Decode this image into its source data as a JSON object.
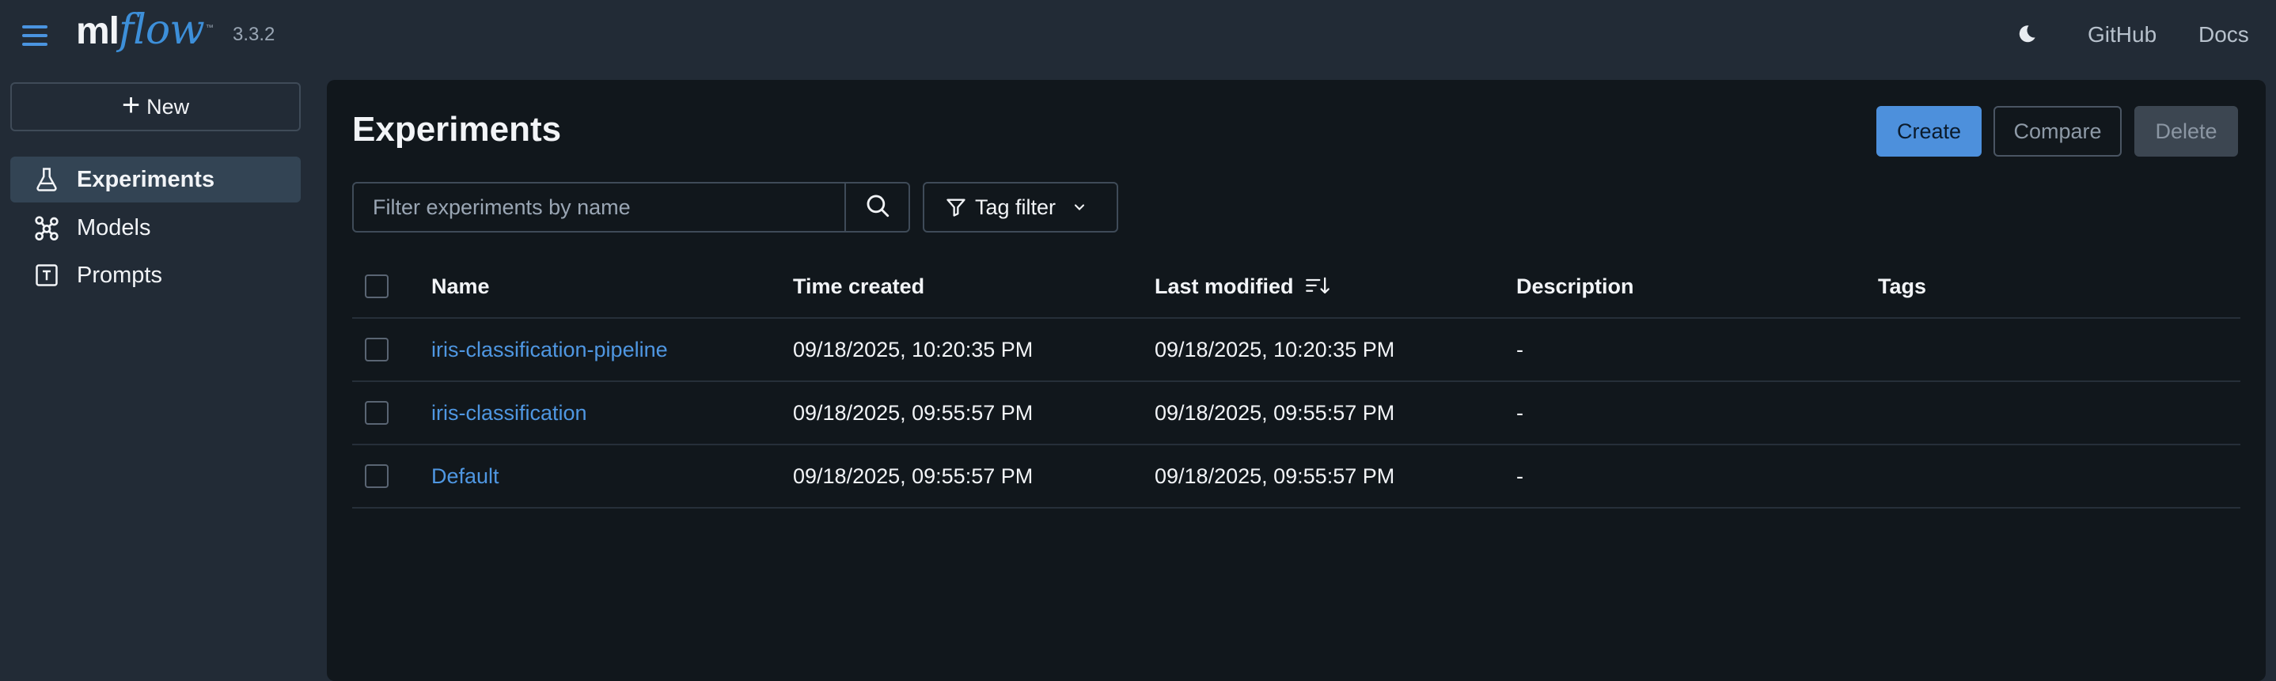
{
  "topbar": {
    "logo_ml": "ml",
    "logo_flow": "flow",
    "logo_tm": "™",
    "version": "3.3.2",
    "github_label": "GitHub",
    "docs_label": "Docs"
  },
  "sidebar": {
    "new_label": "New",
    "items": [
      {
        "label": "Experiments",
        "icon": "flask-icon",
        "active": true
      },
      {
        "label": "Models",
        "icon": "models-icon",
        "active": false
      },
      {
        "label": "Prompts",
        "icon": "prompt-icon",
        "active": false
      }
    ]
  },
  "main": {
    "title": "Experiments",
    "buttons": {
      "create": "Create",
      "compare": "Compare",
      "delete": "Delete"
    },
    "search": {
      "placeholder": "Filter experiments by name"
    },
    "tag_filter_label": "Tag filter",
    "table": {
      "columns": [
        "Name",
        "Time created",
        "Last modified",
        "Description",
        "Tags"
      ],
      "rows": [
        {
          "name": "iris-classification-pipeline",
          "created": "09/18/2025, 10:20:35 PM",
          "modified": "09/18/2025, 10:20:35 PM",
          "description": "-",
          "tags": ""
        },
        {
          "name": "iris-classification",
          "created": "09/18/2025, 09:55:57 PM",
          "modified": "09/18/2025, 09:55:57 PM",
          "description": "-",
          "tags": ""
        },
        {
          "name": "Default",
          "created": "09/18/2025, 09:55:57 PM",
          "modified": "09/18/2025, 09:55:57 PM",
          "description": "-",
          "tags": ""
        }
      ]
    }
  },
  "colors": {
    "accent": "#4d90dc",
    "link": "#4f97e2",
    "background": "#222b36",
    "panel": "#11171c"
  }
}
